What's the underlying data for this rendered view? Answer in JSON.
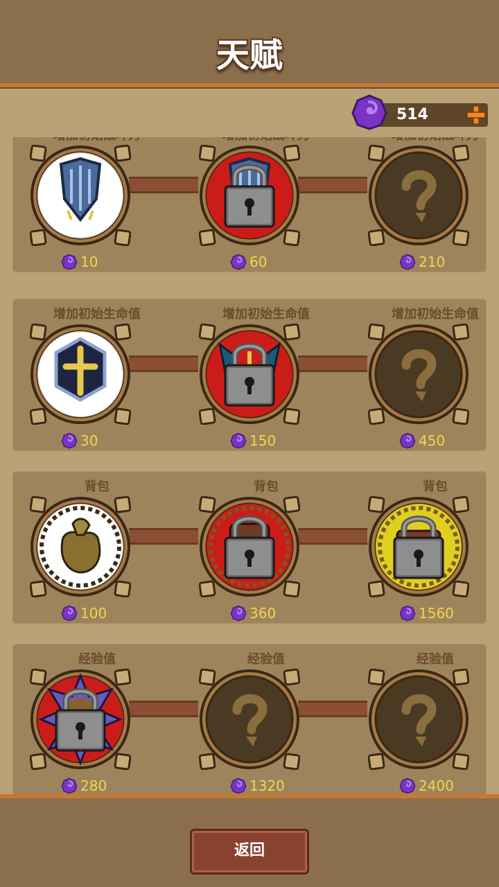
{
  "header": {
    "title": "天赋"
  },
  "currency": {
    "count": "514",
    "icon": "purple-gem-icon",
    "add_icon": "plus-icon"
  },
  "rows": [
    {
      "nodes": [
        {
          "label": "增加初始战斗力",
          "cost": "10",
          "state": "unlocked",
          "art": "shield-icon"
        },
        {
          "label": "增加初始战斗力",
          "cost": "60",
          "state": "locked",
          "art": "shield-icon"
        },
        {
          "label": "增加初始战斗力",
          "cost": "210",
          "state": "unknown",
          "art": "question-icon"
        }
      ]
    },
    {
      "nodes": [
        {
          "label": "增加初始生命值",
          "cost": "30",
          "state": "unlocked",
          "art": "cross-emblem-icon"
        },
        {
          "label": "增加初始生命值",
          "cost": "150",
          "state": "locked",
          "art": "winged-shield-icon"
        },
        {
          "label": "增加初始生命值",
          "cost": "450",
          "state": "unknown",
          "art": "question-icon"
        }
      ]
    },
    {
      "nodes": [
        {
          "label": "背包",
          "cost": "100",
          "state": "unlocked",
          "art": "sack-icon"
        },
        {
          "label": "背包",
          "cost": "360",
          "state": "locked",
          "art": "backpack-icon"
        },
        {
          "label": "背包",
          "cost": "1560",
          "state": "locked-yellow",
          "art": "chest-icon"
        }
      ]
    },
    {
      "nodes": [
        {
          "label": "经验值",
          "cost": "280",
          "state": "locked",
          "art": "spiked-orb-icon"
        },
        {
          "label": "经验值",
          "cost": "1320",
          "state": "unknown",
          "art": "question-icon"
        },
        {
          "label": "经验值",
          "cost": "2400",
          "state": "unknown",
          "art": "question-icon"
        }
      ]
    }
  ],
  "footer": {
    "back_label": "返回"
  },
  "colors": {
    "gem": "#8a3fd1",
    "price": "#f5d44a",
    "accent": "#c47a34"
  }
}
